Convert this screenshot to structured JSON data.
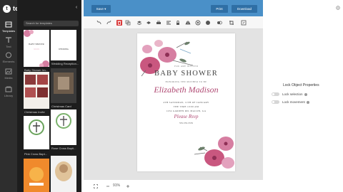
{
  "brand": {
    "name": "templett",
    "logo": "t"
  },
  "rail": [
    {
      "label": "Templates",
      "icon": "templates-icon"
    },
    {
      "label": "Text",
      "icon": "text-icon"
    },
    {
      "label": "Elements",
      "icon": "elements-icon"
    },
    {
      "label": "Media",
      "icon": "media-icon"
    },
    {
      "label": "Library",
      "icon": "library-icon"
    }
  ],
  "panel": {
    "search_placeholder": "Search for templates",
    "templates": [
      {
        "caption": "",
        "title": "BABY SHOWER"
      },
      {
        "caption": "Wedding Reception...",
        "title": "WEDDING"
      },
      {
        "caption": "Baby Shower Inv...",
        "title": ""
      },
      {
        "caption": "Christmas Card",
        "title": ""
      },
      {
        "caption": "Christmas Invite",
        "title": ""
      },
      {
        "caption": "Rose Cross Bapti...",
        "title": ""
      },
      {
        "caption": "Pink Cross Bapt...",
        "title": ""
      },
      {
        "caption": "",
        "title": ""
      },
      {
        "caption": "",
        "title": ""
      }
    ]
  },
  "topbar": {
    "save_label": "Save",
    "print_label": "Print",
    "download_label": "Download"
  },
  "invite": {
    "pre": "YOU ARE INVITED",
    "title": "BABY SHOWER",
    "subtitle": "HONORING THE MOTHER TO BE",
    "name": "Elizabeth Madison",
    "date": "4TH SATURDAY, 11TH OF JANUARY",
    "time": "THE TIME 10:00 AM",
    "address": "1234 GARDEN RD. MACON, GA",
    "rsvp": "Please Rsvp",
    "phone": "555-555-5555"
  },
  "footer": {
    "zoom": "91%"
  },
  "props": {
    "title": "Lock Object Properties",
    "lock_selection": "Lock selection",
    "lock_movement": "Lock movement"
  },
  "colors": {
    "accent": "#4a90c8",
    "active_tool": "#d93838",
    "flower": "#c9577f"
  }
}
